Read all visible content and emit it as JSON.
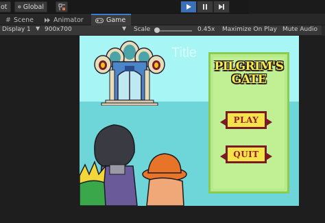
{
  "toolbar": {
    "pivot_label": "ot",
    "global_label": "Global",
    "play_state": "playing",
    "accent": "#3b6fb6"
  },
  "tabs": [
    {
      "label": "Scene",
      "icon": "scene-hash-icon"
    },
    {
      "label": "Animator",
      "icon": "animator-icon"
    },
    {
      "label": "Game",
      "icon": "gamepad-icon",
      "active": true
    }
  ],
  "game_toolbar": {
    "display": "Display 1",
    "resolution": "900x700",
    "scale_label": "Scale",
    "scale_value": "0.45x",
    "scale_fraction": 0.0,
    "maximize": "Maximize On Play",
    "mute": "Mute Audio"
  },
  "game": {
    "placeholder_title": "Title",
    "logo_line1": "PILGRIM'S",
    "logo_line2": "GATE",
    "play_button": "PLAY",
    "quit_button": "QUIT"
  }
}
